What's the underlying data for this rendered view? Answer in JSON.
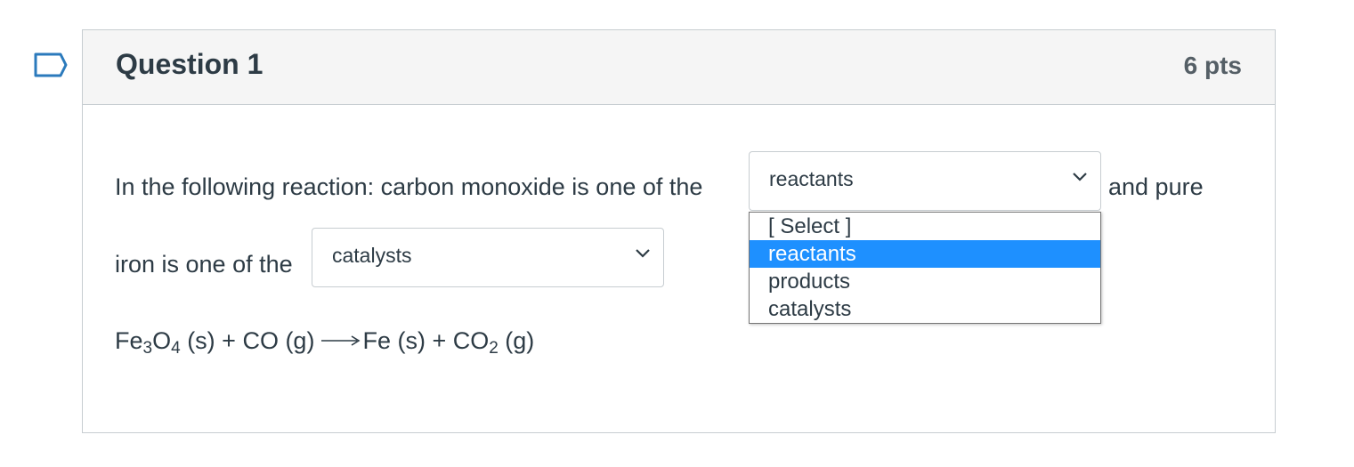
{
  "question": {
    "title": "Question 1",
    "points": "6 pts"
  },
  "body": {
    "text_part1": "In the following reaction: carbon monoxide is one of the",
    "text_part2": "and pure",
    "text_part3": "iron is one of the"
  },
  "select1": {
    "value": "reactants",
    "expanded": true,
    "options": [
      "[ Select ]",
      "reactants",
      "products",
      "catalysts"
    ],
    "highlighted_option": "reactants"
  },
  "select2": {
    "value": "catalysts"
  },
  "equation": {
    "lhs_fe": "Fe",
    "lhs_fe_sub": "3",
    "lhs_o": "O",
    "lhs_o_sub": "4",
    "lhs_rest": " (s) + CO (g)",
    "rhs_fe": "Fe (s) + CO",
    "rhs_co_sub": "2",
    "rhs_rest": " (g)"
  },
  "colors": {
    "highlight": "#1e90ff",
    "flag_stroke": "#2b7abc"
  }
}
